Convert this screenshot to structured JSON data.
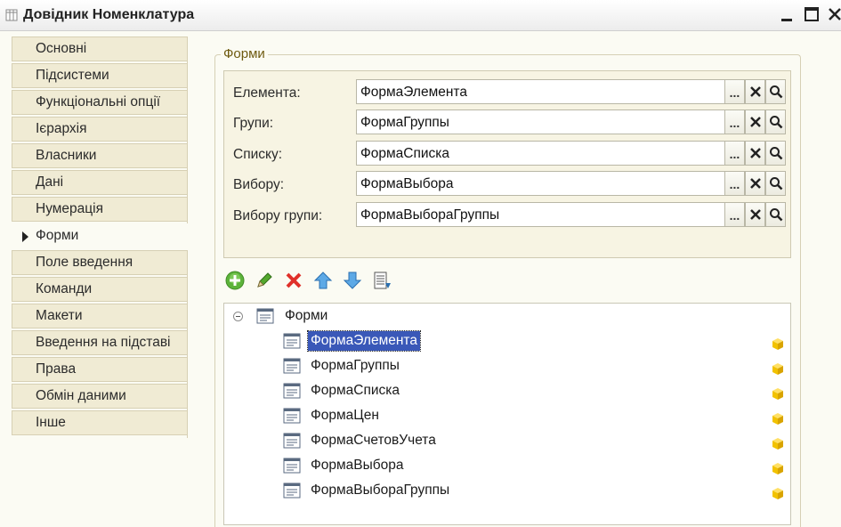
{
  "window": {
    "title": "Довідник Номенклатура",
    "controls": [
      "minimize-icon",
      "maximize-icon",
      "close-icon"
    ]
  },
  "sidebar": {
    "items": [
      {
        "label": "Основні"
      },
      {
        "label": "Підсистеми"
      },
      {
        "label": "Функціональні опції"
      },
      {
        "label": "Ієрархія"
      },
      {
        "label": "Власники"
      },
      {
        "label": "Дані"
      },
      {
        "label": "Нумерація"
      },
      {
        "label": "Форми",
        "active": true
      },
      {
        "label": "Поле введення"
      },
      {
        "label": "Команди"
      },
      {
        "label": "Макети"
      },
      {
        "label": "Введення на підставі"
      },
      {
        "label": "Права"
      },
      {
        "label": "Обмін даними"
      },
      {
        "label": "Інше"
      }
    ]
  },
  "forms_group": {
    "title": "Форми",
    "fields": [
      {
        "label": "Елемента:",
        "value": "ФормаЭлемента"
      },
      {
        "label": "Групи:",
        "value": "ФормаГруппы"
      },
      {
        "label": "Списку:",
        "value": "ФормаСписка"
      },
      {
        "label": "Вибору:",
        "value": "ФормаВыбора"
      },
      {
        "label": "Вибору групи:",
        "value": "ФормаВыбораГруппы"
      }
    ],
    "field_buttons": {
      "select": "...",
      "clear_icon": "clear-x-icon",
      "open_icon": "magnifier-icon"
    }
  },
  "toolbar": {
    "buttons": [
      "add-icon",
      "edit-pencil-icon",
      "delete-icon",
      "move-up-icon",
      "move-down-icon",
      "sort-list-icon"
    ]
  },
  "tree": {
    "root": "Форми",
    "items": [
      {
        "label": "ФормаЭлемента",
        "selected": true
      },
      {
        "label": "ФормаГруппы"
      },
      {
        "label": "ФормаСписка"
      },
      {
        "label": "ФормаЦен"
      },
      {
        "label": "ФормаСчетовУчета"
      },
      {
        "label": "ФормаВыбора"
      },
      {
        "label": "ФормаВыбораГруппы"
      }
    ]
  },
  "colors": {
    "background": "#fbfbf3",
    "tab_background": "#f0ebd4",
    "selection": "#3a58b8",
    "group_title": "#6e5a10",
    "cube_icon": "#f2c200"
  }
}
